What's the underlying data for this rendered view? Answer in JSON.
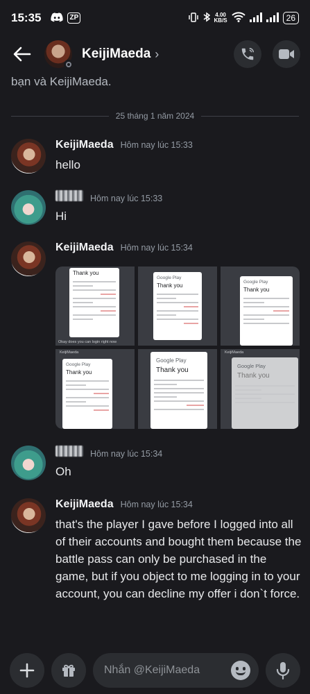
{
  "status_bar": {
    "time": "15:35",
    "app_badge": "ZP",
    "net_speed_value": "4.00",
    "net_speed_unit": "KB/S",
    "battery": "26"
  },
  "header": {
    "title": "KeijiMaeda",
    "chevron": "›"
  },
  "intro_fragment": "bạn và KeijiMaeda.",
  "date_divider": "25 tháng 1 năm 2024",
  "messages": [
    {
      "author": "KeijiMaeda",
      "time": "Hôm nay lúc 15:33",
      "text": "hello"
    },
    {
      "author": "",
      "time": "Hôm nay lúc 15:33",
      "text": "Hi"
    },
    {
      "author": "KeijiMaeda",
      "time": "Hôm nay lúc 15:34",
      "text": ""
    },
    {
      "author": "",
      "time": "Hôm nay lúc 15:34",
      "text": "Oh"
    },
    {
      "author": "KeijiMaeda",
      "time": "Hôm nay lúc 15:34",
      "text": "that's the player I gave before I logged into all of their accounts and bought them because the battle pass can only be purchased in the game, but if you object to me logging in to your account, you can decline my offer i don`t force."
    }
  ],
  "attachments": [
    {
      "heading": "Thank you",
      "caption": "Okay does you can login right now"
    },
    {
      "heading": "Thank you",
      "brand": "Google Play"
    },
    {
      "heading": "Thank you",
      "brand": "Google Play"
    },
    {
      "heading": "Thank you",
      "brand": "Google Play",
      "top": "KeijiMaeda"
    },
    {
      "heading": "Thank you",
      "brand": "Google Play"
    },
    {
      "heading": "Thank you",
      "brand": "Google Play",
      "top": "KeijiMaeda"
    }
  ],
  "composer": {
    "placeholder": "Nhắn @KeijiMaeda"
  },
  "icons": {
    "back": "arrow-left-icon",
    "call": "phone-icon",
    "video": "video-camera-icon",
    "add": "plus-icon",
    "gift": "gift-icon",
    "emoji": "emoji-icon",
    "mic": "microphone-icon"
  },
  "colors": {
    "background": "#1a1a1e",
    "surface": "#2b2d31",
    "muted_text": "#949ba4"
  }
}
